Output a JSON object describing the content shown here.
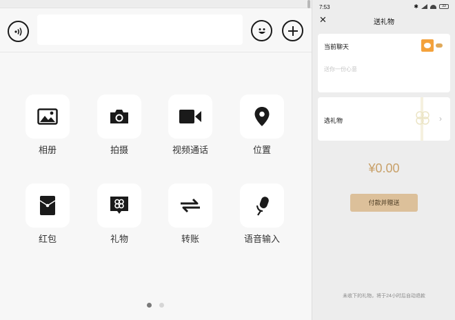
{
  "left": {
    "grid": [
      {
        "label": "相册",
        "icon": "photo-album-icon"
      },
      {
        "label": "拍摄",
        "icon": "camera-icon"
      },
      {
        "label": "视频通话",
        "icon": "video-call-icon"
      },
      {
        "label": "位置",
        "icon": "location-pin-icon"
      },
      {
        "label": "红包",
        "icon": "red-packet-icon"
      },
      {
        "label": "礼物",
        "icon": "gift-icon"
      },
      {
        "label": "转账",
        "icon": "transfer-icon"
      },
      {
        "label": "语音输入",
        "icon": "microphone-icon"
      }
    ],
    "page_indicator": {
      "current": 1,
      "total": 2
    }
  },
  "right": {
    "status": {
      "time": "7:53",
      "battery": "33"
    },
    "nav": {
      "title": "送礼物"
    },
    "recipient": {
      "label": "当前聊天",
      "placeholder": "送你一份心意"
    },
    "gift_select": {
      "label": "选礼物"
    },
    "amount": "¥0.00",
    "pay_button": "付款并赠送",
    "footnote": "未收下的礼物，将于24小时后自动退款"
  },
  "colors": {
    "accent": "#c8a068",
    "button": "#dcc09a",
    "panel": "#ededed"
  }
}
